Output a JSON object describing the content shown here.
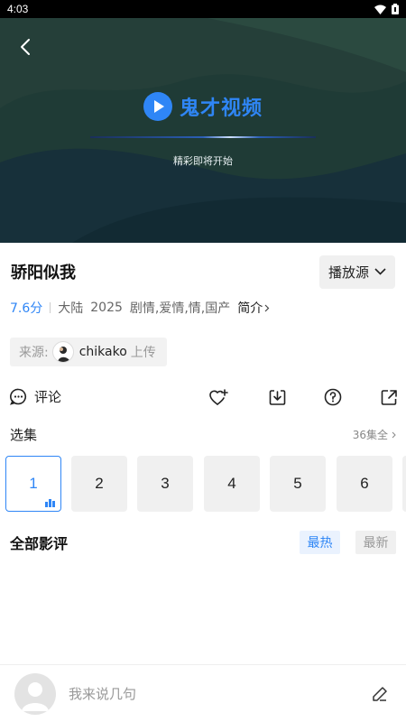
{
  "status_bar": {
    "time": "4:03"
  },
  "player": {
    "brand_name": "鬼才视频",
    "loading_text": "精彩即将开始"
  },
  "video": {
    "title": "骄阳似我",
    "source_button_label": "播放源"
  },
  "meta": {
    "score": "7.6分",
    "region": "大陆",
    "year": "2025",
    "genres": "剧情,爱情,情,国产",
    "intro_label": "简介"
  },
  "uploader": {
    "label": "来源:",
    "name": "chikako",
    "action": "上传"
  },
  "actions": {
    "comment_label": "评论"
  },
  "episodes": {
    "label": "选集",
    "total_label": "36集全",
    "items": [
      "1",
      "2",
      "3",
      "4",
      "5",
      "6"
    ],
    "active_index": 0
  },
  "reviews": {
    "label": "全部影评",
    "sort_hot": "最热",
    "sort_new": "最新"
  },
  "comment_bar": {
    "placeholder": "我来说几句"
  },
  "colors": {
    "accent": "#2f86f6",
    "video_bg": "#1e3a36"
  }
}
